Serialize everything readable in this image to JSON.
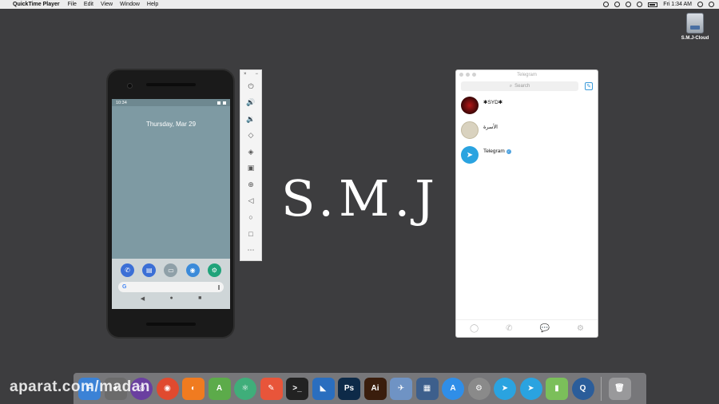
{
  "menubar": {
    "apple": "",
    "app_name": "QuickTime Player",
    "menus": [
      "File",
      "Edit",
      "View",
      "Window",
      "Help"
    ],
    "clock": "Fri 1:34 AM"
  },
  "desktop": {
    "drive_label": "S.M.J-Cloud"
  },
  "phone": {
    "time": "10:34",
    "date": "Thursday, Mar 29",
    "search_glyph": "G",
    "nav": [
      "◀",
      "●",
      "■"
    ]
  },
  "toolbar": {
    "close": "×",
    "minimize": "−",
    "buttons": [
      "⏻",
      "🔊",
      "🔉",
      "◇",
      "◈",
      "▣",
      "⊕",
      "◁",
      "○",
      "□",
      "⋯"
    ]
  },
  "logo": {
    "text": "S.M.J"
  },
  "telegram": {
    "title": "Telegram",
    "search_placeholder": "Search",
    "chats": [
      {
        "name": "✱SYD✱"
      },
      {
        "name": "الأسرة"
      },
      {
        "name": "Telegram"
      }
    ],
    "tabs": [
      "◯",
      "✆",
      "💬",
      "⚙"
    ]
  },
  "watermark": {
    "text": "aparat.com/madan"
  },
  "dock": {
    "items": [
      {
        "label": "F",
        "color": "#3b82d6"
      },
      {
        "label": "⌖",
        "color": "#6b6b6b"
      },
      {
        "label": "◎",
        "color": "#6a3fa0"
      },
      {
        "label": "◉",
        "color": "#e04a2f"
      },
      {
        "label": "◐",
        "color": "#f07b20"
      },
      {
        "label": "A",
        "color": "#5cab4a"
      },
      {
        "label": "⚛",
        "color": "#3fae7a"
      },
      {
        "label": "✎",
        "color": "#e8553a"
      },
      {
        "label": ">_",
        "color": "#222222"
      },
      {
        "label": "◣",
        "color": "#2a6ebf"
      },
      {
        "label": "Ps",
        "color": "#0d2a48"
      },
      {
        "label": "Ai",
        "color": "#3a1d0c"
      },
      {
        "label": "✈",
        "color": "#6f93c4"
      },
      {
        "label": "▦",
        "color": "#3d5f8c"
      },
      {
        "label": "A",
        "color": "#2f8ee8"
      },
      {
        "label": "⚙",
        "color": "#8a8a8a"
      },
      {
        "label": "➤",
        "color": "#2aa3e0"
      },
      {
        "label": "➤",
        "color": "#2aa3e0"
      },
      {
        "label": "▮",
        "color": "#7bbf5a"
      },
      {
        "label": "Q",
        "color": "#2b5d9a"
      }
    ],
    "trash": "🗑"
  },
  "colors": {
    "desktop": "#3d3d3f",
    "telegram_blue": "#3a9ad9"
  }
}
